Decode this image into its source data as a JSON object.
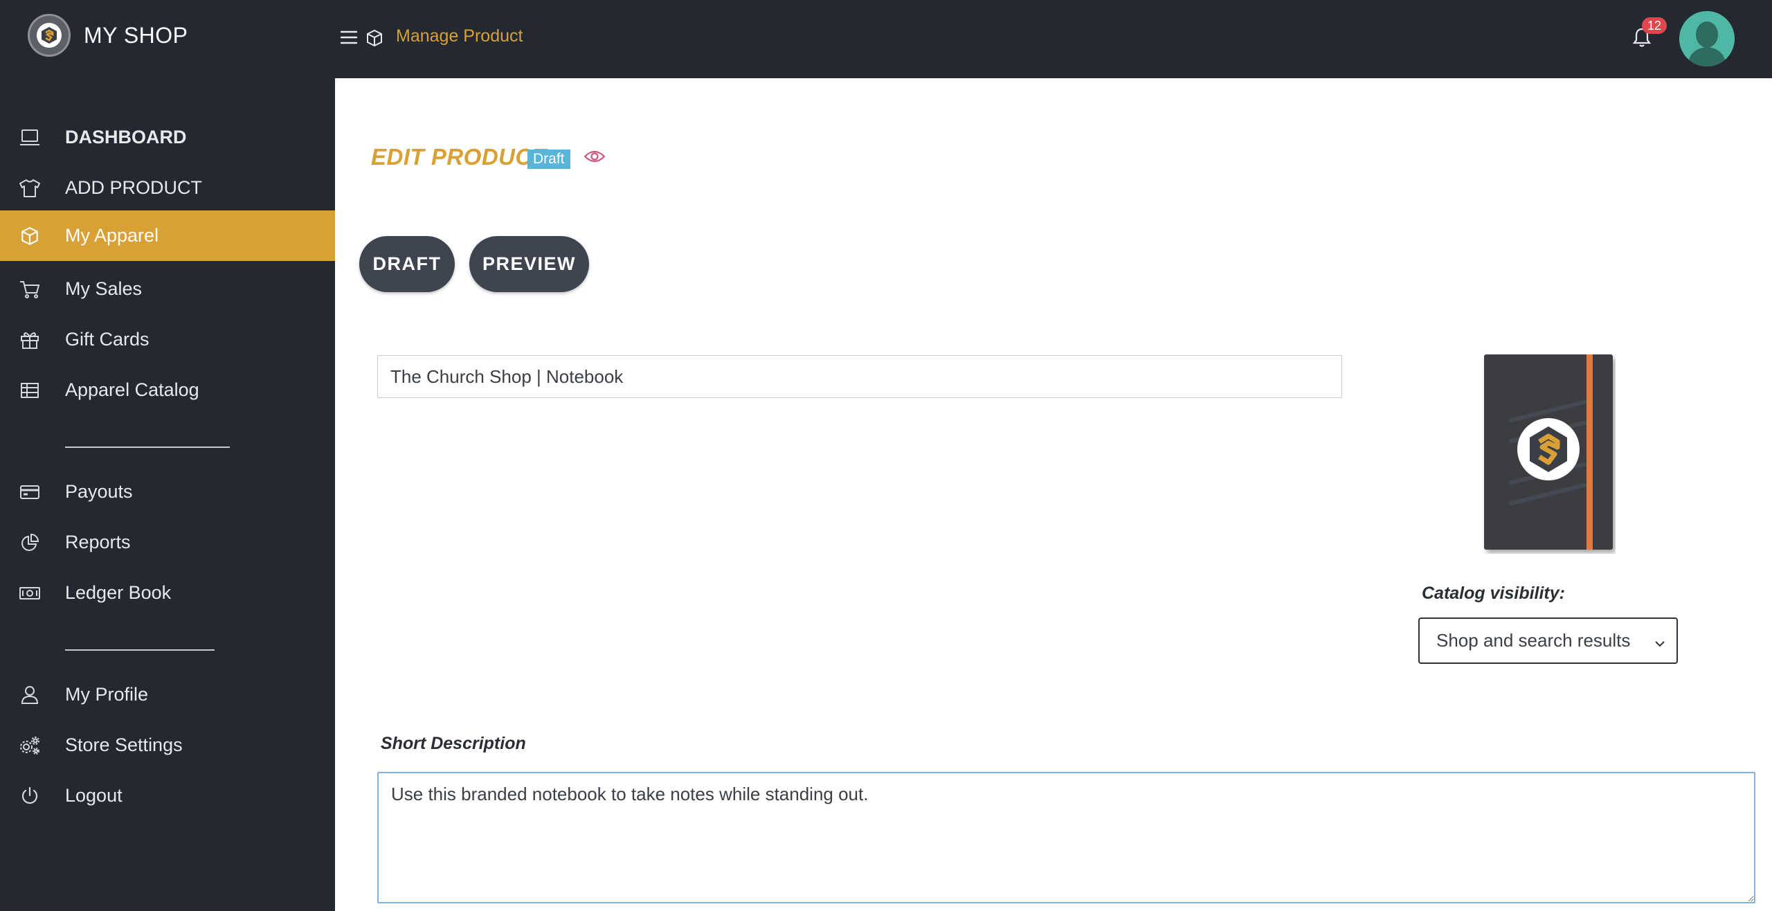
{
  "app": {
    "name": "MY SHOP"
  },
  "header": {
    "breadcrumb": "Manage Product",
    "notification_count": "12"
  },
  "sidebar": {
    "items": [
      {
        "label": "DASHBOARD",
        "icon": "laptop-icon"
      },
      {
        "label": "ADD PRODUCT",
        "icon": "tshirt-icon"
      },
      {
        "label": "My Apparel",
        "icon": "box-icon",
        "active": true
      },
      {
        "label": "My Sales",
        "icon": "cart-icon"
      },
      {
        "label": "Gift Cards",
        "icon": "gift-icon"
      },
      {
        "label": "Apparel Catalog",
        "icon": "table-icon"
      },
      {
        "label": "Payouts",
        "icon": "credit-card-icon"
      },
      {
        "label": "Reports",
        "icon": "pie-chart-icon"
      },
      {
        "label": "Ledger Book",
        "icon": "money-icon"
      },
      {
        "label": "My Profile",
        "icon": "user-icon"
      },
      {
        "label": "Store Settings",
        "icon": "gears-icon"
      },
      {
        "label": "Logout",
        "icon": "power-icon"
      }
    ]
  },
  "main": {
    "title": "EDIT PRODUCT",
    "status": "Draft",
    "buttons": {
      "draft": "DRAFT",
      "preview": "PREVIEW"
    },
    "product_title_value": "The Church Shop | Notebook",
    "catalog_visibility": {
      "label": "Catalog visibility:",
      "selected": "Shop and search results"
    },
    "short_description": {
      "label": "Short Description",
      "value": "Use this branded notebook to take notes while standing out."
    }
  },
  "colors": {
    "sidebar_bg": "#232831",
    "accent": "#d9a035",
    "pill_button": "#3e4550",
    "status_badge": "#58b4d8",
    "notification_badge": "#e0474c",
    "avatar": "#4fb8a4"
  }
}
